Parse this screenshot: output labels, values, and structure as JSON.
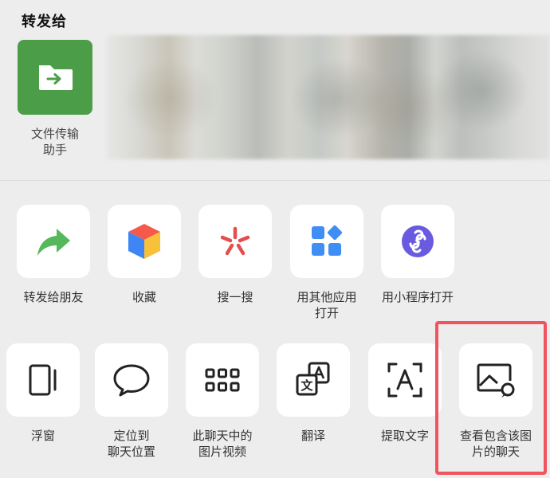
{
  "share_sheet": {
    "section_title": "转发给",
    "contact": {
      "name": "文件传输\n助手",
      "avatar_color": "#4c9d47",
      "icon": "folder-arrow-icon"
    },
    "row1": [
      {
        "label": "转发给朋友",
        "icon": "forward-arrow-icon"
      },
      {
        "label": "收藏",
        "icon": "favorites-cube-icon"
      },
      {
        "label": "搜一搜",
        "icon": "search-burst-icon"
      },
      {
        "label": "用其他应用\n打开",
        "icon": "apps-grid-icon"
      },
      {
        "label": "用小程序打开",
        "icon": "mini-program-icon"
      }
    ],
    "row2": [
      {
        "label": "浮窗",
        "icon": "float-window-icon"
      },
      {
        "label": "定位到\n聊天位置",
        "icon": "chat-bubble-icon"
      },
      {
        "label": "此聊天中的\n图片视频",
        "icon": "grid-dots-icon"
      },
      {
        "label": "翻译",
        "icon": "translate-icon"
      },
      {
        "label": "提取文字",
        "icon": "scan-text-icon"
      },
      {
        "label": "查看包含该图\n片的聊天",
        "icon": "image-chat-icon"
      }
    ],
    "highlight_color": "#f0555f"
  }
}
